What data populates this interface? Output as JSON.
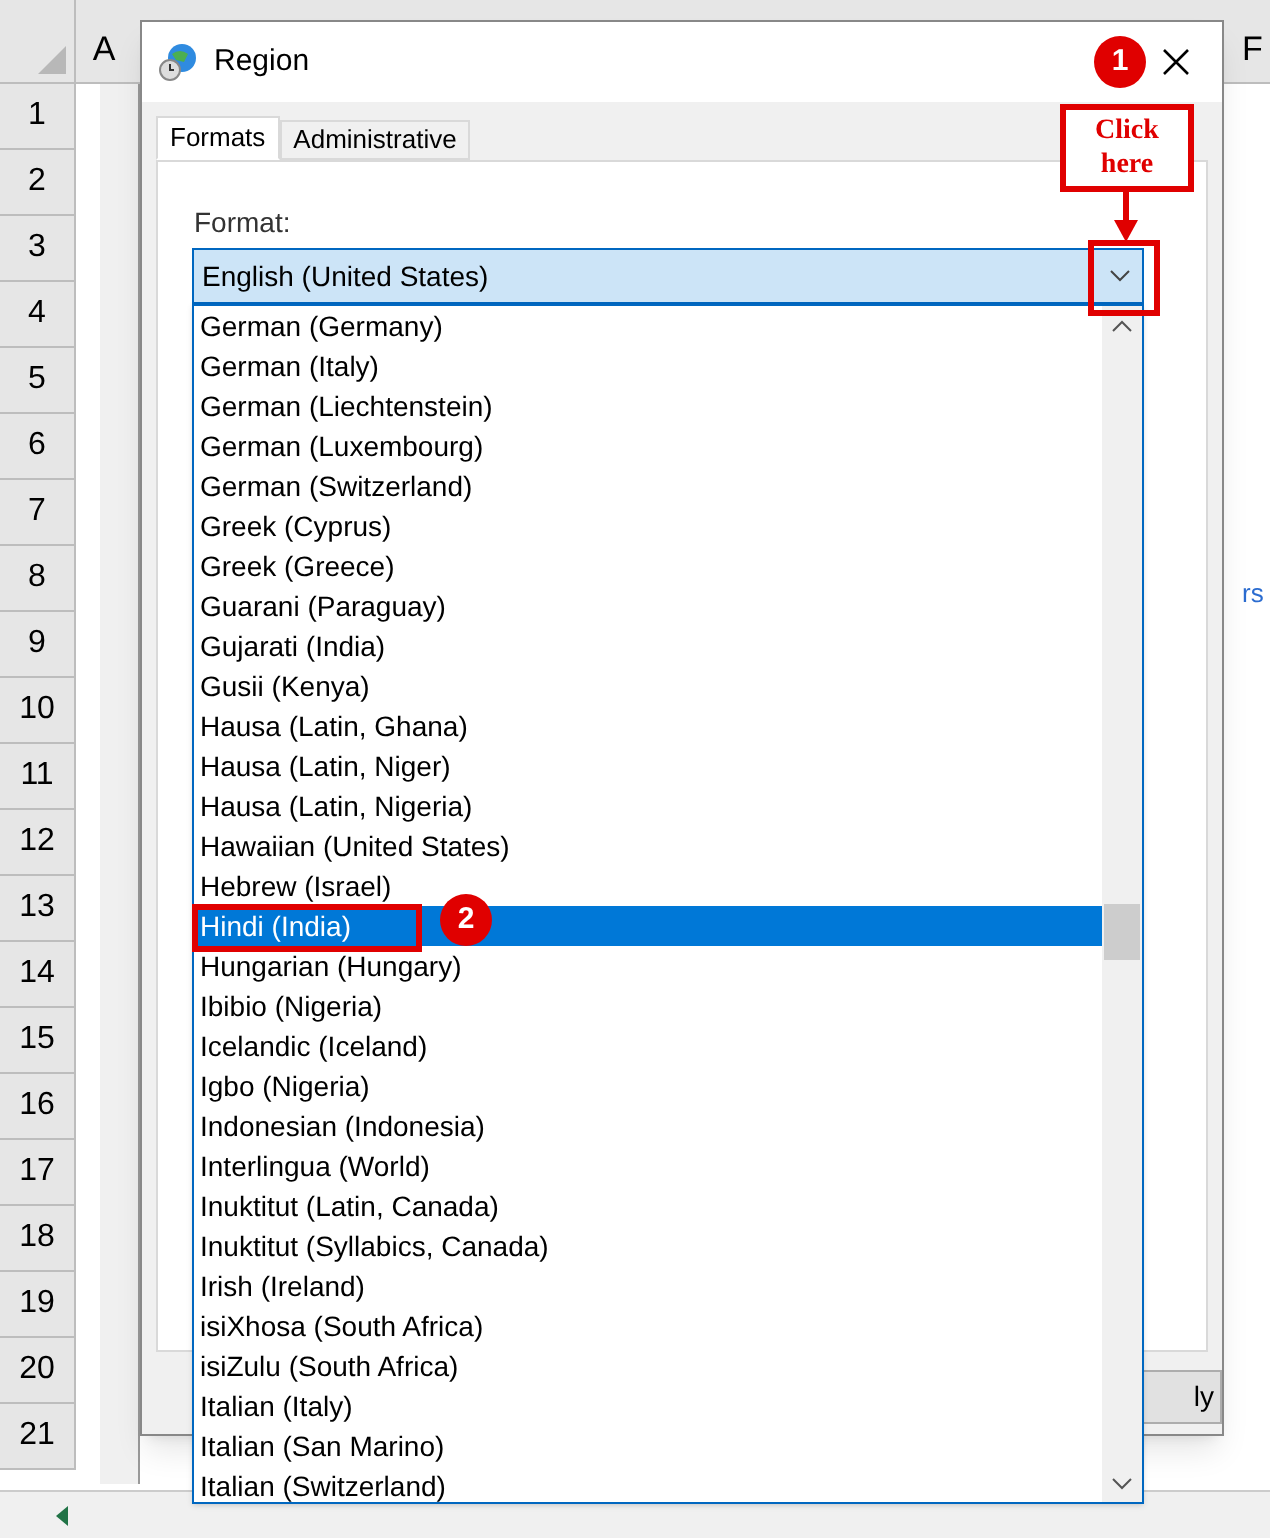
{
  "sheet": {
    "column_headers": [
      "A",
      "F"
    ],
    "row_headers": [
      "1",
      "2",
      "3",
      "4",
      "5",
      "6",
      "7",
      "8",
      "9",
      "10",
      "11",
      "12",
      "13",
      "14",
      "15",
      "16",
      "17",
      "18",
      "19",
      "20",
      "21"
    ],
    "side_text": "rs"
  },
  "window": {
    "title": "Region"
  },
  "tabs": [
    {
      "label": "Formats",
      "selected": true
    },
    {
      "label": "Administrative",
      "selected": false
    }
  ],
  "format": {
    "label": "Format:",
    "value": "English (United States)",
    "expanded": true,
    "options": [
      {
        "label": "German (Germany)",
        "selected": false
      },
      {
        "label": "German (Italy)",
        "selected": false
      },
      {
        "label": "German (Liechtenstein)",
        "selected": false
      },
      {
        "label": "German (Luxembourg)",
        "selected": false
      },
      {
        "label": "German (Switzerland)",
        "selected": false
      },
      {
        "label": "Greek (Cyprus)",
        "selected": false
      },
      {
        "label": "Greek (Greece)",
        "selected": false
      },
      {
        "label": "Guarani (Paraguay)",
        "selected": false
      },
      {
        "label": "Gujarati (India)",
        "selected": false
      },
      {
        "label": "Gusii (Kenya)",
        "selected": false
      },
      {
        "label": "Hausa (Latin, Ghana)",
        "selected": false
      },
      {
        "label": "Hausa (Latin, Niger)",
        "selected": false
      },
      {
        "label": "Hausa (Latin, Nigeria)",
        "selected": false
      },
      {
        "label": "Hawaiian (United States)",
        "selected": false
      },
      {
        "label": "Hebrew (Israel)",
        "selected": false
      },
      {
        "label": "Hindi (India)",
        "selected": true
      },
      {
        "label": "Hungarian (Hungary)",
        "selected": false
      },
      {
        "label": "Ibibio (Nigeria)",
        "selected": false
      },
      {
        "label": "Icelandic (Iceland)",
        "selected": false
      },
      {
        "label": "Igbo (Nigeria)",
        "selected": false
      },
      {
        "label": "Indonesian (Indonesia)",
        "selected": false
      },
      {
        "label": "Interlingua (World)",
        "selected": false
      },
      {
        "label": "Inuktitut (Latin, Canada)",
        "selected": false
      },
      {
        "label": "Inuktitut (Syllabics, Canada)",
        "selected": false
      },
      {
        "label": "Irish (Ireland)",
        "selected": false
      },
      {
        "label": "isiXhosa (South Africa)",
        "selected": false
      },
      {
        "label": "isiZulu (South Africa)",
        "selected": false
      },
      {
        "label": "Italian (Italy)",
        "selected": false
      },
      {
        "label": "Italian (San Marino)",
        "selected": false
      },
      {
        "label": "Italian (Switzerland)",
        "selected": false
      }
    ]
  },
  "apply_button": {
    "label": "ly"
  },
  "annotations": [
    {
      "kind": "step",
      "label": "1"
    },
    {
      "kind": "callout",
      "label": "Click here"
    },
    {
      "kind": "step",
      "label": "2"
    }
  ]
}
